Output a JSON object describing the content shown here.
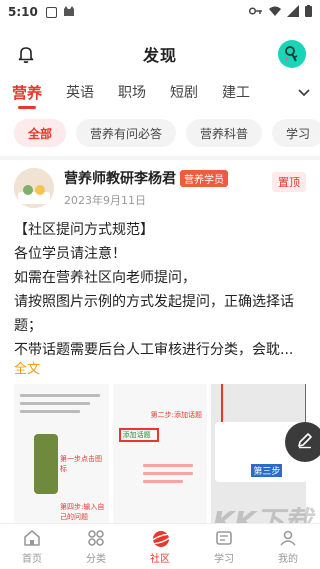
{
  "status_bar": {
    "time": "5:10"
  },
  "header": {
    "title": "发现"
  },
  "category_tabs": [
    {
      "label": "营养",
      "active": true
    },
    {
      "label": "英语",
      "active": false
    },
    {
      "label": "职场",
      "active": false
    },
    {
      "label": "短剧",
      "active": false
    },
    {
      "label": "建工",
      "active": false
    }
  ],
  "chips": [
    {
      "label": "全部",
      "active": true
    },
    {
      "label": "营养有问必答",
      "active": false
    },
    {
      "label": "营养科普",
      "active": false
    },
    {
      "label": "学习",
      "active": false
    }
  ],
  "post": {
    "author": "营养师教研李杨君",
    "badge": "营养学员",
    "date": "2023年9月11日",
    "pin_label": "置顶",
    "lines": [
      "【社区提问方式规范】",
      "各位学员请注意！",
      "如需在营养社区向老师提问，",
      "请按照图片示例的方式发起提问，正确选择话题；",
      "不带话题需要后台人工审核进行分类，会耽..."
    ],
    "full_text_link": "全文",
    "thumb_labels": {
      "step1": "第一步点击图标",
      "step2": "第二步:添加话题",
      "step3": "第三步",
      "step4": "第四步:输入自己的问题",
      "add_topic": "添加话题"
    }
  },
  "bottom_tabs": [
    {
      "label": "首页",
      "icon": "home-icon",
      "active": false
    },
    {
      "label": "分类",
      "icon": "grid-icon",
      "active": false
    },
    {
      "label": "社区",
      "icon": "planet-icon",
      "active": true
    },
    {
      "label": "学习",
      "icon": "study-icon",
      "active": false
    },
    {
      "label": "我的",
      "icon": "user-icon",
      "active": false
    }
  ],
  "watermark": {
    "text": "KK下载",
    "url": "www.kkx.net"
  },
  "colors": {
    "accent": "#e8382e",
    "link": "#f39c12"
  }
}
